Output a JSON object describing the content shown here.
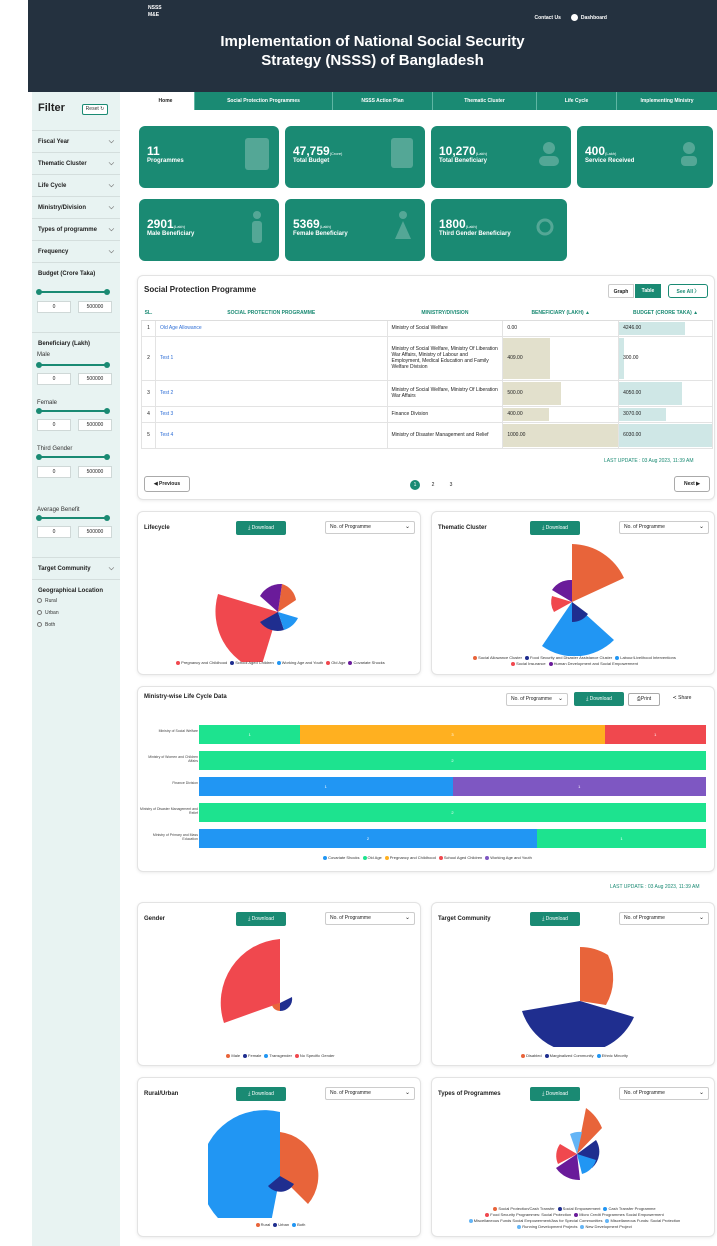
{
  "header": {
    "brand_line1": "NSSS",
    "brand_line2": "M&E",
    "contact": "Contact Us",
    "dashboard": "Dashboard",
    "title_line1": "Implementation of National Social Security",
    "title_line2": "Strategy (NSSS) of Bangladesh"
  },
  "sidebar": {
    "title": "Filter",
    "reset": "Reset ↻",
    "items": [
      "Fiscal Year",
      "Thematic Cluster",
      "Life Cycle",
      "Ministry/Division",
      "Types of programme",
      "Frequency"
    ],
    "budget_label": "Budget (Crore Taka)",
    "beneficiary_label": "Beneficiary (Lakh)",
    "male": "Male",
    "female": "Female",
    "third_gender": "Third Gender",
    "average_benefit": "Average Benefit",
    "min": "0",
    "max": "500000",
    "target_community": "Target Community",
    "geo_label": "Geographical Location",
    "geo_options": [
      "Rural",
      "Urban",
      "Both"
    ]
  },
  "tabs": [
    "Home",
    "Social Protection Programmes",
    "NSSS Action Plan",
    "Thematic Cluster",
    "Life Cycle",
    "Implementing Ministry"
  ],
  "cards": [
    {
      "num": "11",
      "unit": "",
      "label": "Programmes"
    },
    {
      "num": "47,759",
      "unit": "(Crore)",
      "label": "Total Budget"
    },
    {
      "num": "10,270",
      "unit": "(Lakh)",
      "label": "Total Beneficiary"
    },
    {
      "num": "400",
      "unit": "(Lakh)",
      "label": "Service Received"
    },
    {
      "num": "2901",
      "unit": "(Lakh)",
      "label": "Male Beneficiary"
    },
    {
      "num": "5369",
      "unit": "(Lakh)",
      "label": "Female Beneficiary"
    },
    {
      "num": "1800",
      "unit": "(Lakh)",
      "label": "Third Gender Beneficiary"
    }
  ],
  "spp": {
    "title": "Social Protection Programme",
    "graph": "Graph",
    "table": "Table",
    "see_all": "See All 〉",
    "headers": [
      "SL.",
      "SOCIAL PROTECTION PROGRAMME",
      "MINISTRY/DIVISION",
      "BENEFICIARY (LAKH)",
      "BUDGET (CRORE TAKA)"
    ],
    "rows": [
      {
        "sl": "1",
        "name": "Old Age Allowance",
        "ministry": "Ministry of Social Welfare",
        "ben": "0.00",
        "bud": "4246.00",
        "benv": 0,
        "budv": 4246
      },
      {
        "sl": "2",
        "name": "Test 1",
        "ministry": "Ministry of Social Welfare, Ministry Of Liberation War Affairs, Ministry of Labour and Employment, Medical Education and Family Welfare Division",
        "ben": "409.00",
        "bud": "300.00",
        "benv": 409,
        "budv": 300
      },
      {
        "sl": "3",
        "name": "Test 2",
        "ministry": "Ministry of Social Welfare, Ministry Of Liberation War Affairs",
        "ben": "500.00",
        "bud": "4050.00",
        "benv": 500,
        "budv": 4050
      },
      {
        "sl": "4",
        "name": "Test 3",
        "ministry": "Finance Division",
        "ben": "400.00",
        "bud": "3070.00",
        "benv": 400,
        "budv": 3070
      },
      {
        "sl": "5",
        "name": "Test 4",
        "ministry": "Ministry of Disaster Management and Relief",
        "ben": "1000.00",
        "bud": "6030.00",
        "benv": 1000,
        "budv": 6030
      }
    ],
    "last_update": "LAST UPDATE : 03 Aug 2023, 11:39 AM",
    "prev": "◀ Previous",
    "next": "Next ▶",
    "pages": [
      "1",
      "2",
      "3"
    ]
  },
  "common": {
    "download": "⤓ Download",
    "select": "No. of Programme",
    "print": "⎙Print",
    "share": "≺ Share"
  },
  "lifecycle": {
    "title": "Lifecycle",
    "legend": [
      {
        "n": "Pregnancy and Childhood",
        "c": "#f0484e"
      },
      {
        "n": "School Aged Children",
        "c": "#1f2e8f"
      },
      {
        "n": "Working Age and Youth",
        "c": "#2196f3"
      },
      {
        "n": "Old Age",
        "c": "#f0484e"
      },
      {
        "n": "Covariate Shocks",
        "c": "#6a1b9a"
      }
    ]
  },
  "thematic": {
    "title": "Thematic Cluster",
    "legend1": [
      {
        "n": "Social Allowance Cluster",
        "c": "#e8643a"
      },
      {
        "n": "Food Security and Disaster Assistance Cluster",
        "c": "#1f2e8f"
      },
      {
        "n": "Labour/Livelihood Interventions",
        "c": "#2196f3"
      }
    ],
    "legend2": [
      {
        "n": "Social Insurance",
        "c": "#f0484e"
      },
      {
        "n": "Human Development and Social Empowerment",
        "c": "#6a1b9a"
      }
    ]
  },
  "ministry_lc": {
    "title": "Ministry-wise Life Cycle Data",
    "rows": [
      {
        "label": "Ministry of Social Welfare",
        "segs": [
          {
            "v": 1,
            "c": "#1de38f"
          },
          {
            "v": 3,
            "c": "#ffb020"
          },
          {
            "v": 1,
            "c": "#f0484e"
          }
        ]
      },
      {
        "label": "Ministry of Women and Children Affairs",
        "segs": [
          {
            "v": 2,
            "c": "#1de38f"
          }
        ]
      },
      {
        "label": "Finance Division",
        "segs": [
          {
            "v": 1,
            "c": "#2196f3"
          },
          {
            "v": 1,
            "c": "#7e57c2"
          }
        ]
      },
      {
        "label": "Ministry of Disaster Management and Relief",
        "segs": [
          {
            "v": 2,
            "c": "#1de38f"
          }
        ]
      },
      {
        "label": "Ministry of Primary and Mass Education",
        "segs": [
          {
            "v": 2,
            "c": "#2196f3"
          },
          {
            "v": 1,
            "c": "#1de38f"
          }
        ]
      }
    ],
    "legend": [
      {
        "n": "Covariate Shocks",
        "c": "#2196f3"
      },
      {
        "n": "Old Age",
        "c": "#1de38f"
      },
      {
        "n": "Pregnancy and Childhood",
        "c": "#ffb020"
      },
      {
        "n": "School Aged Children",
        "c": "#f0484e"
      },
      {
        "n": "Working Age and Youth",
        "c": "#7e57c2"
      }
    ],
    "last_update": "LAST UPDATE : 03 Aug 2023, 11:39 AM"
  },
  "gender": {
    "title": "Gender",
    "legend": [
      {
        "n": "Male",
        "c": "#e8643a"
      },
      {
        "n": "Female",
        "c": "#1f2e8f"
      },
      {
        "n": "Transgender",
        "c": "#2196f3"
      },
      {
        "n": "No Specific Gender",
        "c": "#f0484e"
      }
    ]
  },
  "target": {
    "title": "Target Community",
    "legend": [
      {
        "n": "Disabled",
        "c": "#e8643a"
      },
      {
        "n": "Marginalized Community",
        "c": "#1f2e8f"
      },
      {
        "n": "Ethnic Minority",
        "c": "#2196f3"
      }
    ]
  },
  "rural": {
    "title": "Rural/Urban",
    "legend": [
      {
        "n": "Rural",
        "c": "#e8643a"
      },
      {
        "n": "Urban",
        "c": "#1f2e8f"
      },
      {
        "n": "Both",
        "c": "#2196f3"
      }
    ]
  },
  "types": {
    "title": "Types of Programmes",
    "legend_lines": [
      [
        {
          "n": "Social Protection/Cash Transfer",
          "c": "#e8643a"
        },
        {
          "n": "Social Empowerment",
          "c": "#1f2e8f"
        },
        {
          "n": "Cash Transfer Programme",
          "c": "#2196f3"
        }
      ],
      [
        {
          "n": "Food Security Programmes: Social Protection",
          "c": "#f0484e"
        },
        {
          "n": "Micro Credit Programmes Social Empowerment",
          "c": "#6a1b9a"
        }
      ],
      [
        {
          "n": "Miscellaneous Funds Social Empowerment/Ass for Special Communities",
          "c": "#64b5f6"
        },
        {
          "n": "Miscellaneous Funds: Social Protection",
          "c": "#64b5f6"
        }
      ],
      [
        {
          "n": "Running Development Projects",
          "c": "#64b5f6"
        },
        {
          "n": "New Development Project",
          "c": "#64b5f6"
        }
      ]
    ]
  },
  "chart_data": [
    {
      "type": "bar",
      "title": "Ministry-wise Life Cycle Data",
      "categories": [
        "Ministry of Social Welfare",
        "Ministry of Women and Children Affairs",
        "Finance Division",
        "Ministry of Disaster Management and Relief",
        "Ministry of Primary and Mass Education"
      ],
      "series": [
        {
          "name": "Covariate Shocks",
          "values": [
            0,
            0,
            1,
            0,
            2
          ]
        },
        {
          "name": "Old Age",
          "values": [
            1,
            2,
            0,
            2,
            1
          ]
        },
        {
          "name": "Pregnancy and Childhood",
          "values": [
            3,
            0,
            0,
            0,
            0
          ]
        },
        {
          "name": "School Aged Children",
          "values": [
            1,
            0,
            0,
            0,
            0
          ]
        },
        {
          "name": "Working Age and Youth",
          "values": [
            0,
            0,
            1,
            0,
            0
          ]
        }
      ]
    }
  ]
}
